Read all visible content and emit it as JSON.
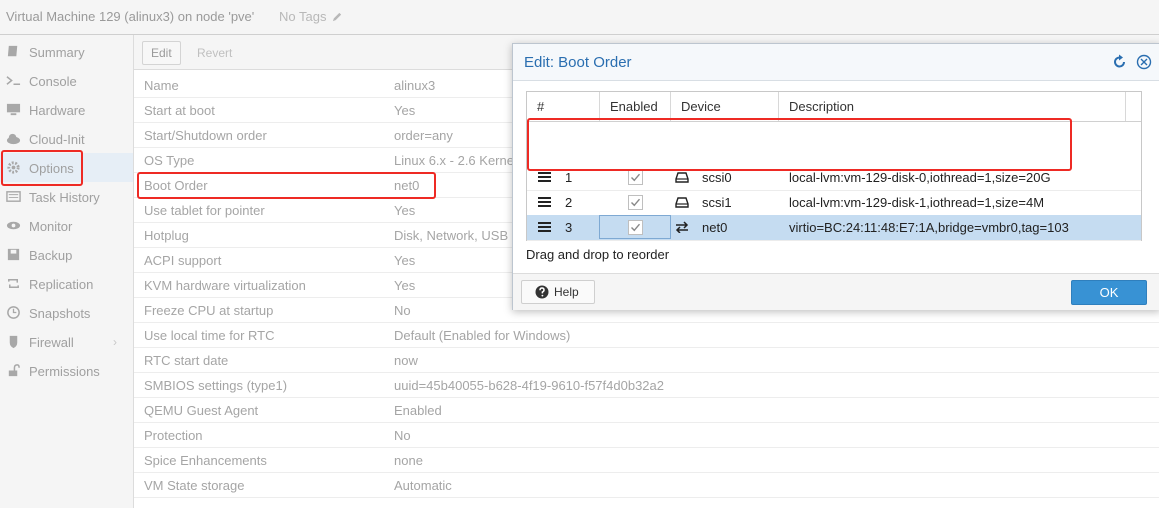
{
  "header": {
    "title": "Virtual Machine 129 (alinux3) on node 'pve'",
    "tags": "No Tags"
  },
  "nav": {
    "items": [
      {
        "label": "Summary",
        "icon": "book-icon"
      },
      {
        "label": "Console",
        "icon": "terminal-icon"
      },
      {
        "label": "Hardware",
        "icon": "monitor-icon"
      },
      {
        "label": "Cloud-Init",
        "icon": "cloud-icon"
      },
      {
        "label": "Options",
        "icon": "gear-icon",
        "active": true
      },
      {
        "label": "Task History",
        "icon": "list-icon"
      },
      {
        "label": "Monitor",
        "icon": "eye-icon"
      },
      {
        "label": "Backup",
        "icon": "floppy-icon"
      },
      {
        "label": "Replication",
        "icon": "retweet-icon"
      },
      {
        "label": "Snapshots",
        "icon": "history-icon"
      },
      {
        "label": "Firewall",
        "icon": "shield-icon"
      },
      {
        "label": "Permissions",
        "icon": "unlock-icon"
      }
    ]
  },
  "toolbar": {
    "edit_label": "Edit",
    "revert_label": "Revert"
  },
  "options": [
    {
      "key": "Name",
      "value": "alinux3"
    },
    {
      "key": "Start at boot",
      "value": "Yes"
    },
    {
      "key": "Start/Shutdown order",
      "value": "order=any"
    },
    {
      "key": "OS Type",
      "value": "Linux 6.x - 2.6 Kernel"
    },
    {
      "key": "Boot Order",
      "value": "net0"
    },
    {
      "key": "Use tablet for pointer",
      "value": "Yes"
    },
    {
      "key": "Hotplug",
      "value": "Disk, Network, USB"
    },
    {
      "key": "ACPI support",
      "value": "Yes"
    },
    {
      "key": "KVM hardware virtualization",
      "value": "Yes"
    },
    {
      "key": "Freeze CPU at startup",
      "value": "No"
    },
    {
      "key": "Use local time for RTC",
      "value": "Default (Enabled for Windows)"
    },
    {
      "key": "RTC start date",
      "value": "now"
    },
    {
      "key": "SMBIOS settings (type1)",
      "value": "uuid=45b40055-b628-4f19-9610-f57f4d0b32a2"
    },
    {
      "key": "QEMU Guest Agent",
      "value": "Enabled"
    },
    {
      "key": "Protection",
      "value": "No"
    },
    {
      "key": "Spice Enhancements",
      "value": "none"
    },
    {
      "key": "VM State storage",
      "value": "Automatic"
    }
  ],
  "dialog": {
    "title": "Edit: Boot Order",
    "columns": {
      "num": "#",
      "enabled": "Enabled",
      "device": "Device",
      "description": "Description"
    },
    "rows": [
      {
        "num": "1",
        "enabled": true,
        "device": "scsi0",
        "device_icon": "hdd-icon",
        "description": "local-lvm:vm-129-disk-0,iothread=1,size=20G"
      },
      {
        "num": "2",
        "enabled": true,
        "device": "scsi1",
        "device_icon": "hdd-icon",
        "description": "local-lvm:vm-129-disk-1,iothread=1,size=4M"
      },
      {
        "num": "3",
        "enabled": true,
        "device": "net0",
        "device_icon": "exchange-icon",
        "description": "virtio=BC:24:11:48:E7:1A,bridge=vmbr0,tag=103",
        "selected": true
      }
    ],
    "hint": "Drag and drop to reorder",
    "help_label": "Help",
    "ok_label": "OK"
  },
  "colors": {
    "accent": "#3892d4",
    "highlight": "#ee2a24",
    "selected_row": "#c5dcf1",
    "title_blue": "#2a6eb0"
  }
}
